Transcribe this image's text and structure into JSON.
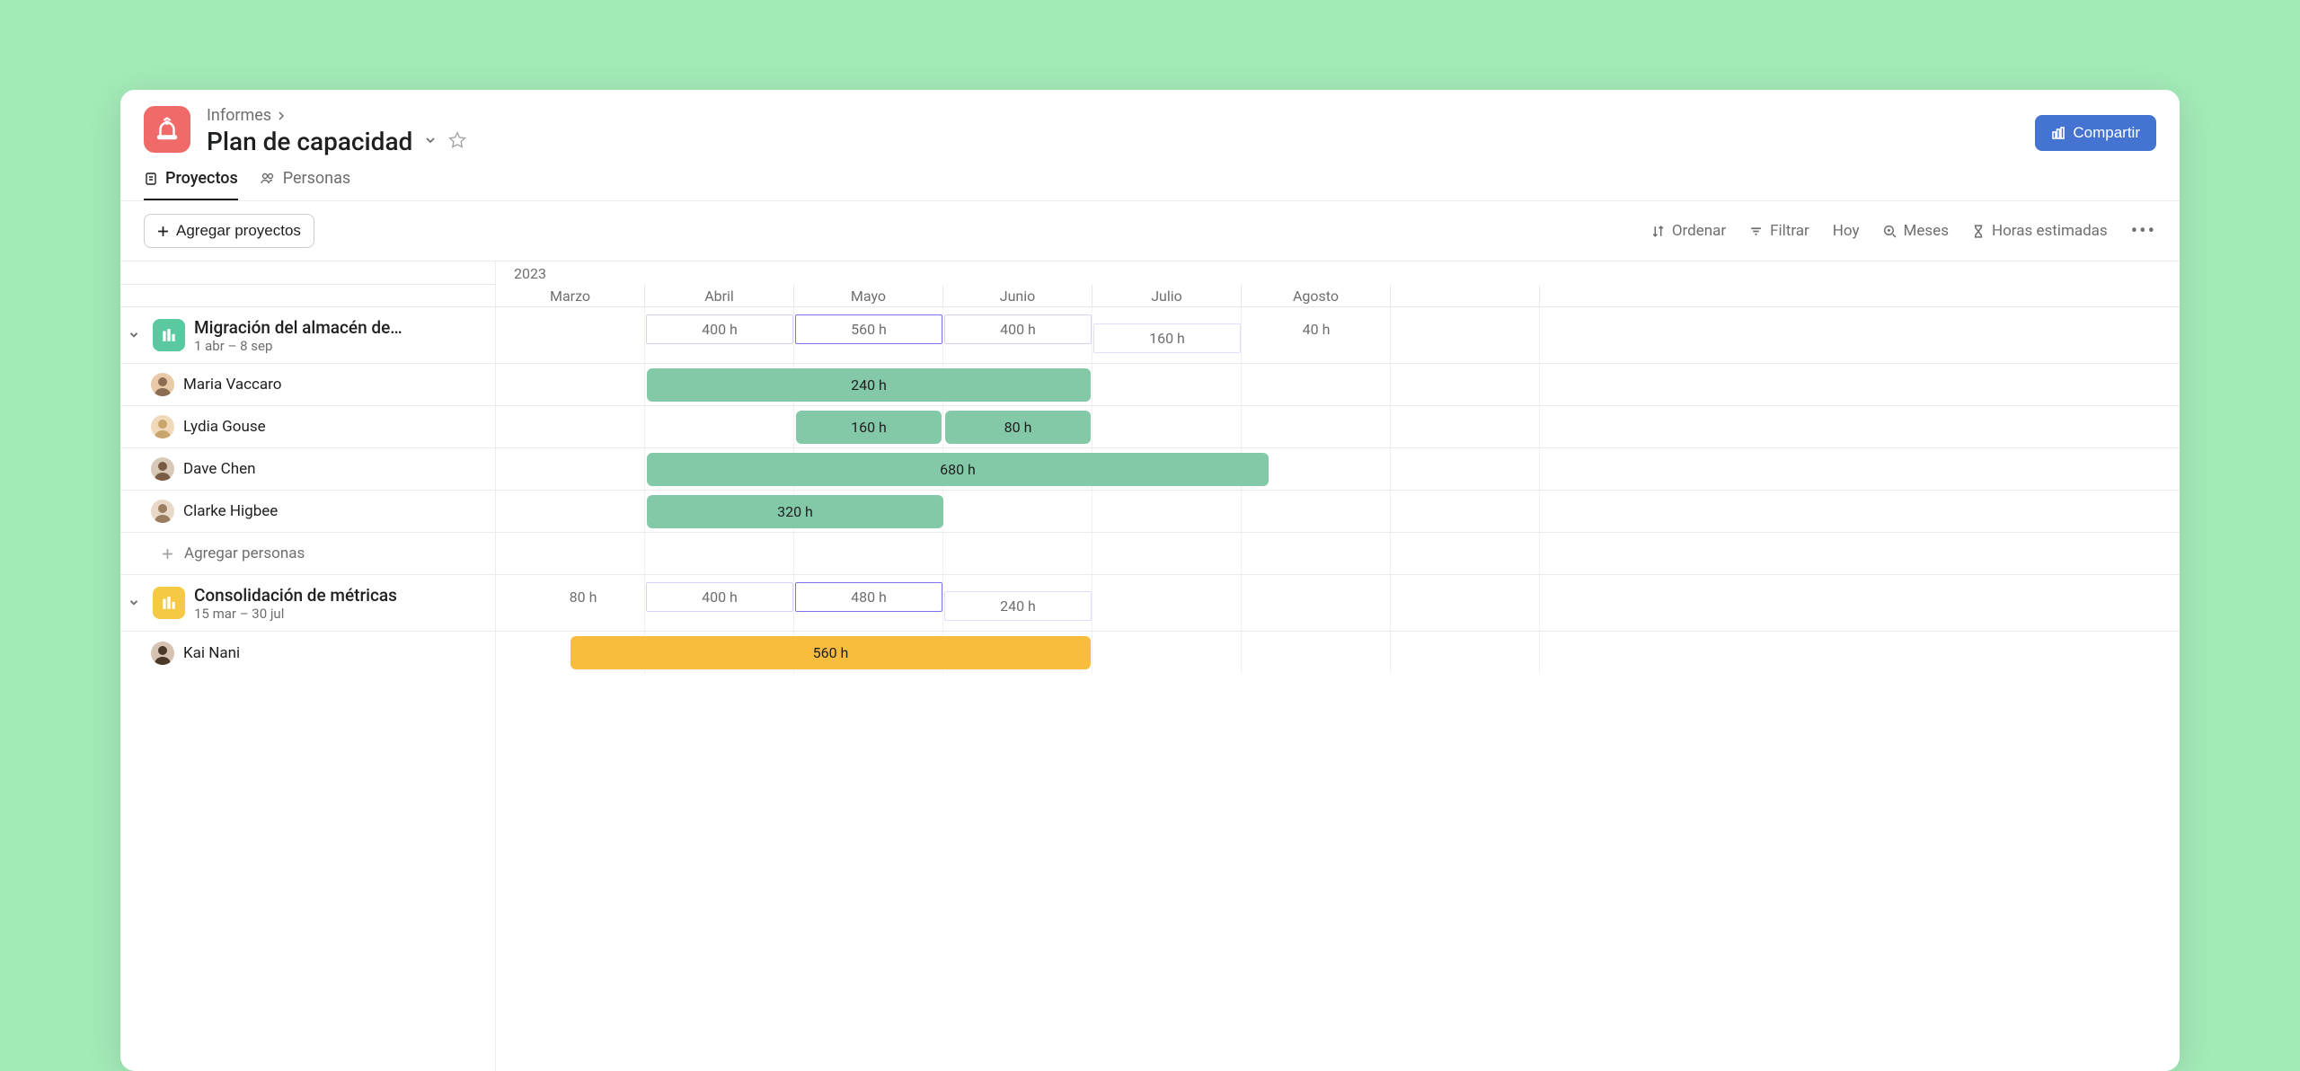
{
  "breadcrumb": {
    "label": "Informes"
  },
  "title": "Plan de capacidad",
  "share_button": "Compartir",
  "tabs": {
    "projects": "Proyectos",
    "people": "Personas"
  },
  "toolbar": {
    "add_projects": "Agregar proyectos",
    "sort": "Ordenar",
    "filter": "Filtrar",
    "today": "Hoy",
    "months": "Meses",
    "estimated": "Horas estimadas"
  },
  "timeline": {
    "year": "2023",
    "months": [
      "Marzo",
      "Abril",
      "Mayo",
      "Junio",
      "Julio",
      "Agosto",
      "—"
    ]
  },
  "projects": [
    {
      "name": "Migración del almacén de…",
      "dates": "1 abr – 8 sep",
      "color": "green",
      "summary": [
        "400 h",
        "560 h",
        "400 h",
        "160 h",
        "40 h"
      ],
      "people": [
        {
          "name": "Maria Vaccaro",
          "bar": {
            "label": "240 h",
            "start": 1,
            "span": 3
          }
        },
        {
          "name": "Lydia Gouse",
          "bars": [
            {
              "label": "160 h",
              "start": 2,
              "span": 1
            },
            {
              "label": "80 h",
              "start": 3,
              "span": 1
            }
          ]
        },
        {
          "name": "Dave Chen",
          "bar": {
            "label": "680 h",
            "start": 1,
            "span": 4.2
          }
        },
        {
          "name": "Clarke Higbee",
          "bar": {
            "label": "320 h",
            "start": 1,
            "span": 2
          }
        }
      ],
      "add_person": "Agregar personas"
    },
    {
      "name": "Consolidación de métricas",
      "dates": "15 mar – 30 jul",
      "color": "yellow",
      "summary": [
        "80 h",
        "400 h",
        "480 h",
        "240 h"
      ],
      "people": [
        {
          "name": "Kai Nani",
          "bar": {
            "label": "560 h",
            "start": 0.5,
            "span": 3.5
          }
        }
      ]
    }
  ]
}
